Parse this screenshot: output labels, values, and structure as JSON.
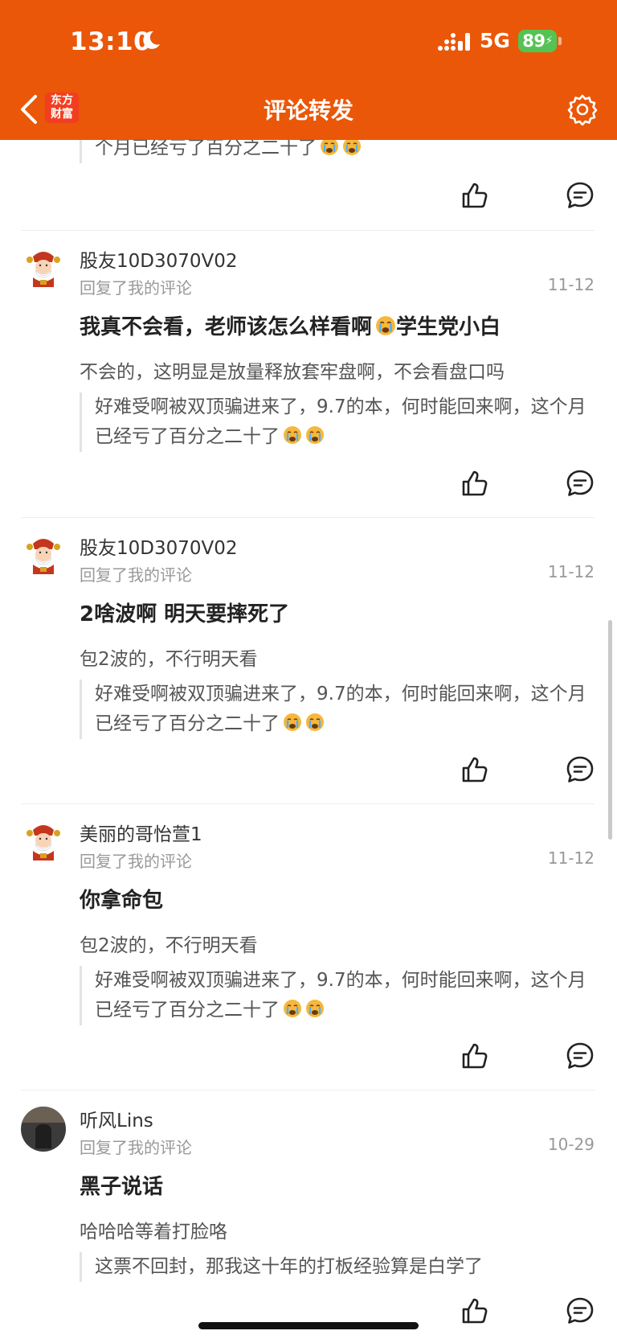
{
  "status_bar": {
    "time": "13:10",
    "network": "5G",
    "battery": "89"
  },
  "header": {
    "title": "评论转发",
    "logo_line1": "东方",
    "logo_line2": "财富"
  },
  "top_partial": {
    "quote": "个月已经亏了百分之二十了"
  },
  "items": [
    {
      "username": "股友10D3070V02",
      "subtitle": "回复了我的评论",
      "date": "11-12",
      "reply_before": "我真不会看，老师该怎么样看啊",
      "reply_after": "学生党小白",
      "original": "不会的，这明显是放量释放套牢盘啊，不会看盘口吗",
      "quote": "好难受啊被双顶骗进来了，9.7的本，何时能回来啊，这个月已经亏了百分之二十了"
    },
    {
      "username": "股友10D3070V02",
      "subtitle": "回复了我的评论",
      "date": "11-12",
      "reply": "2啥波啊 明天要摔死了",
      "original": "包2波的，不行明天看",
      "quote": "好难受啊被双顶骗进来了，9.7的本，何时能回来啊，这个月已经亏了百分之二十了"
    },
    {
      "username": "美丽的哥怡萱1",
      "subtitle": "回复了我的评论",
      "date": "11-12",
      "reply": "你拿命包",
      "original": "包2波的，不行明天看",
      "quote": "好难受啊被双顶骗进来了，9.7的本，何时能回来啊，这个月已经亏了百分之二十了"
    },
    {
      "username": "听风Lins",
      "subtitle": "回复了我的评论",
      "date": "10-29",
      "reply": "黑子说话",
      "original": "哈哈哈等着打脸咯",
      "quote": "这票不回封，那我这十年的打板经验算是白学了"
    }
  ],
  "colors": {
    "brand": "#ea5708",
    "battery": "#55c353"
  },
  "icons": [
    "moon-icon",
    "signal-icon",
    "back-chevron-icon",
    "gear-icon",
    "thumbs-up-icon",
    "comment-bubble-icon",
    "crying-emoji-icon"
  ]
}
